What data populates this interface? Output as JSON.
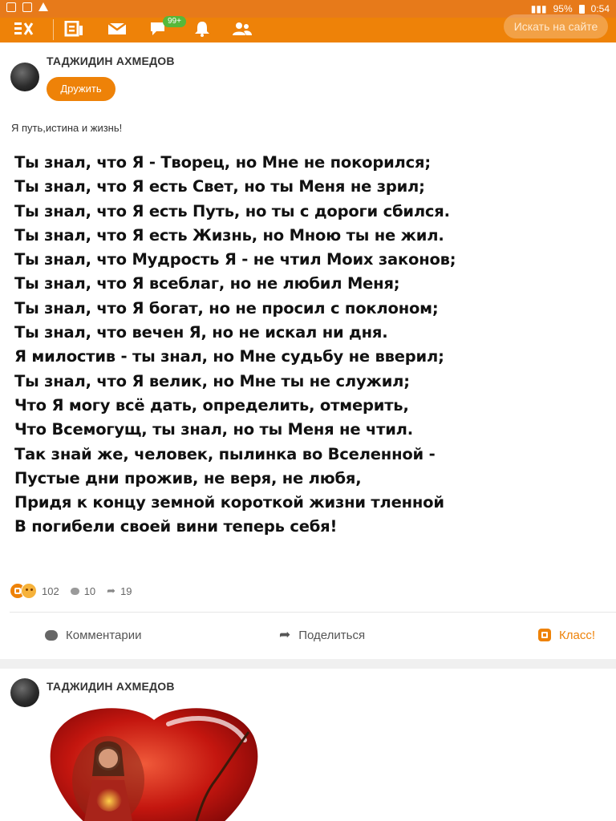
{
  "status_bar": {
    "battery": "95%",
    "time": "0:54"
  },
  "toolbar": {
    "badge": "99+",
    "search_label": "Искать на сайте"
  },
  "post1": {
    "author": "ТАДЖИДИН АХМЕДОВ",
    "friend_button": "Дружить",
    "subtitle": "Я путь,истина и жизнь!",
    "poem_lines": [
      "Ты знал, что Я - Творец, но Мне не покорился;",
      "Ты знал, что Я есть Свет, но ты Меня не зрил;",
      "Ты знал, что Я есть Путь, но ты с дороги сбился.",
      "Ты знал, что Я есть Жизнь, но Мною ты не жил.",
      "Ты знал, что Мудрость Я - не чтил Моих законов;",
      "Ты знал, что Я всеблаг, но не любил Меня;",
      "Ты знал, что Я богат, но не просил с поклоном;",
      "Ты знал, что вечен Я, но не искал ни дня.",
      "Я милостив - ты знал, но Мне судьбу не вверил;",
      "Ты знал, что Я велик, но Мне ты не служил;",
      "Что Я могу всё дать, определить, отмерить,",
      "Что Всемогущ, ты знал, но ты Меня не чтил.",
      "Так знай же, человек, пылинка во Вселенной -",
      "Пустые дни прожив, не веря, не любя,",
      "Придя к концу земной короткой жизни тленной",
      "В погибели своей вини теперь себя!"
    ],
    "reactions_count": "102",
    "comments_count": "10",
    "shares_count": "19",
    "actions": {
      "comments": "Комментарии",
      "share": "Поделиться",
      "klass": "Класс!"
    }
  },
  "post2": {
    "author": "ТАДЖИДИН АХМЕДОВ"
  },
  "colors": {
    "accent": "#ee8208",
    "status_bar": "#e77a1a"
  }
}
